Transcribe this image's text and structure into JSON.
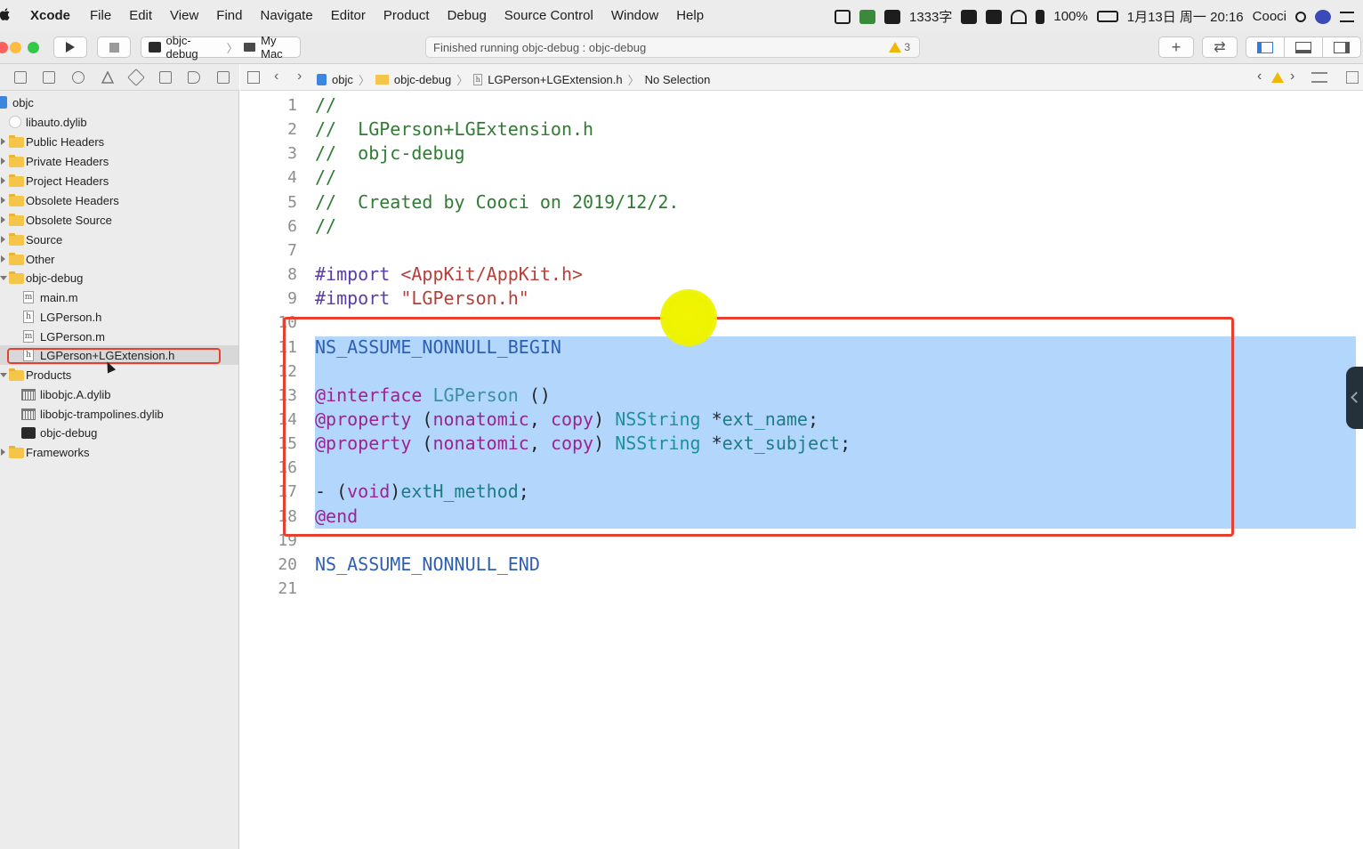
{
  "menubar": {
    "app": "Xcode",
    "items": [
      "File",
      "Edit",
      "View",
      "Find",
      "Navigate",
      "Editor",
      "Product",
      "Debug",
      "Source Control",
      "Window",
      "Help"
    ],
    "status": {
      "counter": "1333字",
      "battery": "100%",
      "datetime": "1月13日 周一 20:16",
      "user": "Cooci"
    }
  },
  "toolbar": {
    "scheme": "objc-debug",
    "destination": "My Mac",
    "activity": "Finished running objc-debug : objc-debug",
    "warning_count": "3"
  },
  "navigator": {
    "items": [
      {
        "label": "objc",
        "kind": "project"
      },
      {
        "label": "libauto.dylib",
        "kind": "dylib"
      },
      {
        "label": "Public Headers",
        "kind": "folder"
      },
      {
        "label": "Private Headers",
        "kind": "folder"
      },
      {
        "label": "Project Headers",
        "kind": "folder"
      },
      {
        "label": "Obsolete Headers",
        "kind": "folder"
      },
      {
        "label": "Obsolete Source",
        "kind": "folder"
      },
      {
        "label": "Source",
        "kind": "folder"
      },
      {
        "label": "Other",
        "kind": "folder"
      },
      {
        "label": "objc-debug",
        "kind": "folder"
      },
      {
        "label": "main.m",
        "kind": "file",
        "glyph": "m"
      },
      {
        "label": "LGPerson.h",
        "kind": "file",
        "glyph": "h"
      },
      {
        "label": "LGPerson.m",
        "kind": "file",
        "glyph": "m"
      },
      {
        "label": "LGPerson+LGExtension.h",
        "kind": "file",
        "glyph": "h"
      },
      {
        "label": "Products",
        "kind": "folder"
      },
      {
        "label": "libobjc.A.dylib",
        "kind": "lib"
      },
      {
        "label": "libobjc-trampolines.dylib",
        "kind": "lib"
      },
      {
        "label": "objc-debug",
        "kind": "exe"
      },
      {
        "label": "Frameworks",
        "kind": "folder"
      }
    ]
  },
  "jumpbar": {
    "crumbs": [
      "objc",
      "objc-debug",
      "LGPerson+LGExtension.h",
      "No Selection"
    ]
  },
  "editor": {
    "lines": [
      {
        "n": "1",
        "segs": [
          [
            "c-comment",
            "//"
          ]
        ]
      },
      {
        "n": "2",
        "segs": [
          [
            "c-comment",
            "//  LGPerson+LGExtension.h"
          ]
        ]
      },
      {
        "n": "3",
        "segs": [
          [
            "c-comment",
            "//  objc-debug"
          ]
        ]
      },
      {
        "n": "4",
        "segs": [
          [
            "c-comment",
            "//"
          ]
        ]
      },
      {
        "n": "5",
        "segs": [
          [
            "c-comment",
            "//  Created by Cooci on 2019/12/2."
          ]
        ]
      },
      {
        "n": "6",
        "segs": [
          [
            "c-comment",
            "//"
          ]
        ]
      },
      {
        "n": "7",
        "segs": []
      },
      {
        "n": "8",
        "segs": [
          [
            "c-pre",
            "#import "
          ],
          [
            "c-str",
            "<AppKit/AppKit.h>"
          ]
        ]
      },
      {
        "n": "9",
        "segs": [
          [
            "c-pre",
            "#import "
          ],
          [
            "c-str",
            "\"LGPerson.h\""
          ]
        ]
      },
      {
        "n": "10",
        "segs": []
      },
      {
        "n": "11",
        "segs": [
          [
            "c-macro",
            "NS_ASSUME_NONNULL_BEGIN"
          ]
        ]
      },
      {
        "n": "12",
        "segs": []
      },
      {
        "n": "13",
        "segs": [
          [
            "c-kw",
            "@interface "
          ],
          [
            "c-cls",
            "LGPerson"
          ],
          [
            "c-plain",
            " ()"
          ]
        ]
      },
      {
        "n": "14",
        "segs": [
          [
            "c-kw",
            "@property"
          ],
          [
            "c-plain",
            " ("
          ],
          [
            "c-kw",
            "nonatomic"
          ],
          [
            "c-plain",
            ", "
          ],
          [
            "c-kw",
            "copy"
          ],
          [
            "c-plain",
            ") "
          ],
          [
            "c-type",
            "NSString"
          ],
          [
            "c-plain",
            " *"
          ],
          [
            "c-method",
            "ext_name"
          ],
          [
            "c-plain",
            ";"
          ]
        ]
      },
      {
        "n": "15",
        "segs": [
          [
            "c-kw",
            "@property"
          ],
          [
            "c-plain",
            " ("
          ],
          [
            "c-kw",
            "nonatomic"
          ],
          [
            "c-plain",
            ", "
          ],
          [
            "c-kw",
            "copy"
          ],
          [
            "c-plain",
            ") "
          ],
          [
            "c-type",
            "NSString"
          ],
          [
            "c-plain",
            " *"
          ],
          [
            "c-method",
            "ext_subject"
          ],
          [
            "c-plain",
            ";"
          ]
        ]
      },
      {
        "n": "16",
        "segs": []
      },
      {
        "n": "17",
        "segs": [
          [
            "c-plain",
            "- ("
          ],
          [
            "c-kw",
            "void"
          ],
          [
            "c-plain",
            ")"
          ],
          [
            "c-method",
            "extH_method"
          ],
          [
            "c-plain",
            ";"
          ]
        ]
      },
      {
        "n": "18",
        "segs": [
          [
            "c-kw",
            "@end"
          ]
        ]
      },
      {
        "n": "19",
        "segs": []
      },
      {
        "n": "20",
        "segs": [
          [
            "c-macro",
            "NS_ASSUME_NONNULL_END"
          ]
        ]
      },
      {
        "n": "21",
        "segs": []
      }
    ]
  },
  "colors": {
    "selection": "#b3d7fc",
    "highlight_box": "#e8402f",
    "cursor_dot": "#f1f500"
  }
}
